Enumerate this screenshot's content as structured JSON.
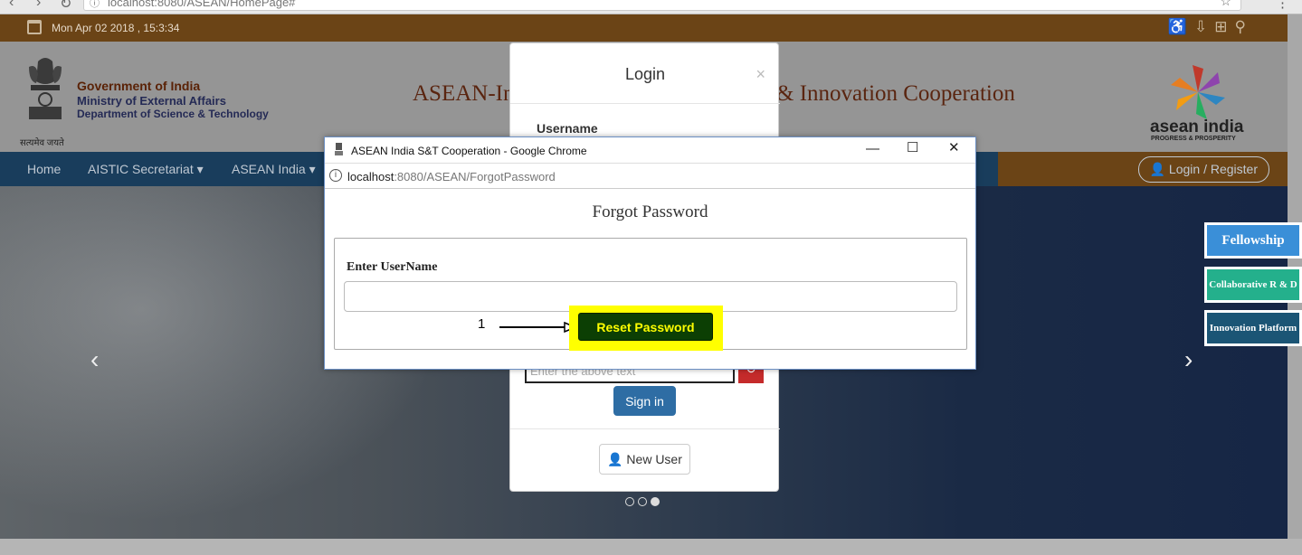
{
  "browser": {
    "url": "localhost:8080/ASEAN/HomePage#"
  },
  "topbar": {
    "datetime": "Mon Apr 02 2018 , 15:3:34"
  },
  "header": {
    "emblem_caption": "सत्यमेव जयते",
    "gov_line1": "Government of India",
    "gov_line2": "Ministry of External Affairs",
    "gov_line3": "Department of Science & Technology",
    "site_title": "ASEAN-In",
    "site_title_right": "& Innovation Cooperation",
    "logo_word": "asean india",
    "logo_tagline": "PROGRESS & PROSPERITY"
  },
  "navbar": {
    "items": [
      "Home",
      "AISTIC Secretariat ▾",
      "ASEAN India ▾"
    ],
    "login": "👤 Login / Register"
  },
  "side_buttons": [
    {
      "label": "Fellowship",
      "color": "#3a8fd8"
    },
    {
      "label": "Collaborative R & D",
      "color": "#24b08c"
    },
    {
      "label": "Innovation Platform",
      "color": "#1b5575"
    }
  ],
  "login_modal": {
    "title": "Login",
    "close": "×",
    "username_label": "Username",
    "captcha_placeholder": "Enter the above text",
    "signin": "Sign in",
    "new_user": "New User"
  },
  "popup": {
    "window_title": "ASEAN India S&T Cooperation - Google Chrome",
    "url_host": "localhost",
    "url_path": ":8080/ASEAN/ForgotPassword",
    "heading": "Forgot Password",
    "field_label": "Enter UserName",
    "field_value": "",
    "annotation_number": "1",
    "reset_button": "Reset Password"
  },
  "colors": {
    "brown_band": "#6b4416",
    "navbar_blue": "#193d5c",
    "reset_bg": "#0c3f04",
    "reset_text": "#ffff00",
    "highlight": "#ffff00"
  }
}
